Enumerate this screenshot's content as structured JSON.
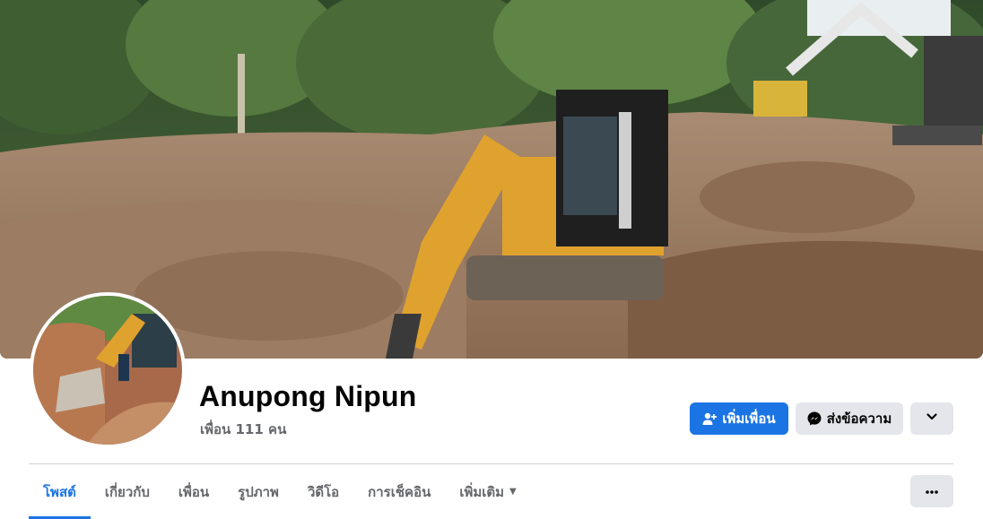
{
  "profile": {
    "name": "Anupong Nipun",
    "friends_count": "เพื่อน 111 คน"
  },
  "actions": {
    "add_friend": "เพิ่มเพื่อน",
    "message": "ส่งข้อความ",
    "more_icon": "chevron-down-icon"
  },
  "tabs": [
    {
      "label": "โพสต์",
      "active": true
    },
    {
      "label": "เกี่ยวกับ",
      "active": false
    },
    {
      "label": "เพื่อน",
      "active": false
    },
    {
      "label": "รูปภาพ",
      "active": false
    },
    {
      "label": "วิดีโอ",
      "active": false
    },
    {
      "label": "การเช็คอิน",
      "active": false
    },
    {
      "label": "เพิ่มเติม",
      "active": false,
      "has_dropdown": true
    }
  ],
  "colors": {
    "accent": "#1b74e4",
    "secondary_button": "#e4e6eb",
    "muted_text": "#65676b"
  }
}
